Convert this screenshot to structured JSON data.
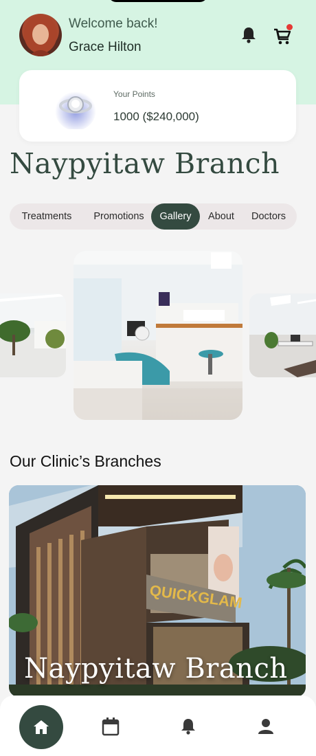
{
  "header": {
    "welcome": "Welcome back!",
    "user_name": "Grace Hilton",
    "cart_has_badge": true
  },
  "points": {
    "label": "Your Points",
    "value": "1000 ($240,000)"
  },
  "branch": {
    "title": "Naypyitaw Branch"
  },
  "tabs": [
    {
      "label": "Treatments",
      "active": false
    },
    {
      "label": "Promotions",
      "active": false
    },
    {
      "label": "Gallery",
      "active": true
    },
    {
      "label": "About",
      "active": false
    },
    {
      "label": "Doctors",
      "active": false
    }
  ],
  "branches_section": {
    "title": "Our Clinic’s Branches",
    "card_label": "Naypyitaw Branch",
    "sign_text": "QUICKGLAM"
  },
  "bottom_nav": {
    "items": [
      "home-icon",
      "calendar-icon",
      "bell-icon",
      "user-icon"
    ],
    "active": "home-icon"
  },
  "colors": {
    "accent": "#344a40",
    "header_bg": "#d6f4e3",
    "badge": "#e53935"
  }
}
